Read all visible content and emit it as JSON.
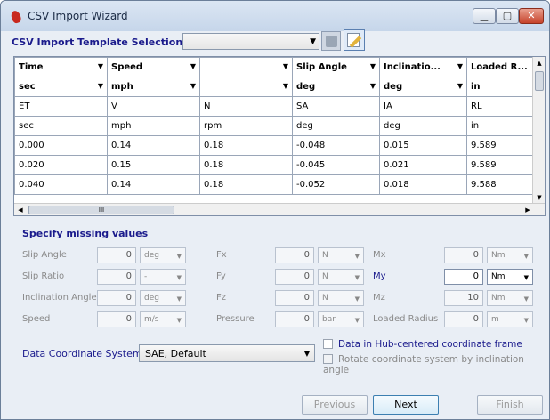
{
  "window": {
    "title": "CSV Import Wizard"
  },
  "template": {
    "label": "CSV Import Template Selection",
    "value": ""
  },
  "grid": {
    "headers": [
      "Time",
      "Speed",
      "",
      "Slip Angle",
      "Inclinatio...",
      "Loaded R..."
    ],
    "units_row": [
      "sec",
      "mph",
      "",
      "deg",
      "deg",
      "in"
    ],
    "rows": [
      [
        "ET",
        "V",
        "N",
        "SA",
        "IA",
        "RL"
      ],
      [
        "sec",
        "mph",
        "rpm",
        "deg",
        "deg",
        "in"
      ],
      [
        "0.000",
        "0.14",
        "0.18",
        "-0.048",
        "0.015",
        "9.589"
      ],
      [
        "0.020",
        "0.15",
        "0.18",
        "-0.045",
        "0.021",
        "9.589"
      ],
      [
        "0.040",
        "0.14",
        "0.18",
        "-0.052",
        "0.018",
        "9.588"
      ]
    ],
    "hscroll_grip": "III"
  },
  "missing": {
    "title": "Specify missing values",
    "col1": [
      {
        "label": "Slip Angle",
        "value": "0",
        "unit": "deg"
      },
      {
        "label": "Slip Ratio",
        "value": "0",
        "unit": "-"
      },
      {
        "label": "Inclination Angle",
        "value": "0",
        "unit": "deg"
      },
      {
        "label": "Speed",
        "value": "0",
        "unit": "m/s"
      }
    ],
    "col2": [
      {
        "label": "Fx",
        "value": "0",
        "unit": "N"
      },
      {
        "label": "Fy",
        "value": "0",
        "unit": "N"
      },
      {
        "label": "Fz",
        "value": "0",
        "unit": "N"
      },
      {
        "label": "Pressure",
        "value": "0",
        "unit": "bar"
      }
    ],
    "col3": [
      {
        "label": "Mx",
        "value": "0",
        "unit": "Nm"
      },
      {
        "label": "My",
        "value": "0",
        "unit": "Nm"
      },
      {
        "label": "Mz",
        "value": "10",
        "unit": "Nm"
      },
      {
        "label": "Loaded Radius",
        "value": "0",
        "unit": "m"
      }
    ]
  },
  "coords": {
    "label": "Data Coordinate System",
    "value": "SAE, Default",
    "hub_centered": "Data in Hub-centered coordinate frame",
    "rotate": "Rotate coordinate system by inclination angle"
  },
  "buttons": {
    "previous": "Previous",
    "next": "Next",
    "finish": "Finish"
  }
}
